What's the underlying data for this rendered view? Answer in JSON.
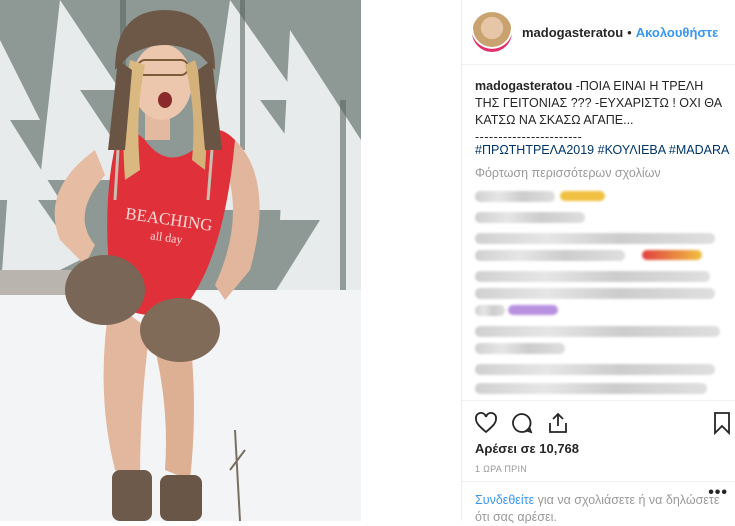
{
  "post": {
    "username": "madogasteratou",
    "dot": "•",
    "follow_label": "Ακολουθήστε",
    "caption_user": "madogasteratou",
    "caption_text": " -ΠΟΙΑ ΕΙΝΑΙ Η ΤΡΕΛΗ ΤΗΣ ΓΕΙΤΟΝΙΑΣ ??? -ΕΥΧΑΡΙΣΤΩ ! ΟΧΙ ΘΑ ΚΑΤΣΩ ΝΑ ΣΚΑΣΩ ΑΓΑΠΕ...",
    "caption_divider": "-----------------------",
    "hashtags": [
      "#ΠΡΩΤΗΤΡΕΛΑ2019",
      "#ΚΟΥΛΙΕΒΑ",
      "#MADARA"
    ],
    "load_more": "Φόρτωση περισσότερων σχολίων",
    "likes": "Αρέσει σε 10,768",
    "time": "1 ΩΡΑ ΠΡΙΝ",
    "login_link": "Συνδεθείτε",
    "login_text": " για να σχολιάσετε ή να δηλώσετε ότι σας αρέσει.",
    "more_options": "•••"
  },
  "photo": {
    "swimsuit_text_1": "BEACHING",
    "swimsuit_text_2": "all day"
  },
  "icons": [
    "heart-icon",
    "comment-icon",
    "share-icon",
    "bookmark-icon"
  ],
  "colors": {
    "accent": "#3897f0",
    "hashtag": "#003569",
    "swimsuit": "#e0303a"
  }
}
